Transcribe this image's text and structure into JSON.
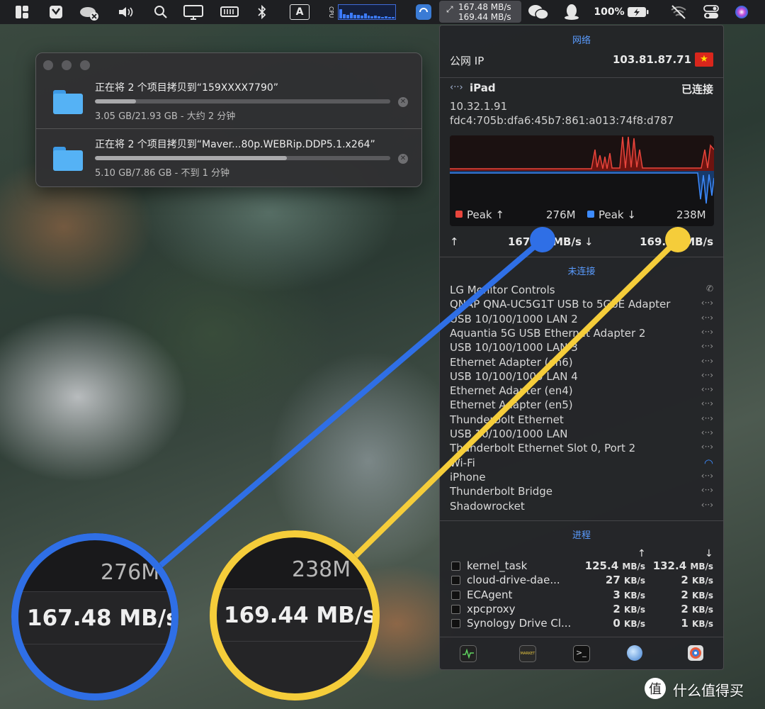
{
  "menubar": {
    "battery_pct": "100%",
    "net_up": "167.48 MB/s",
    "net_down": "169.44 MB/s",
    "cpu_label": "CPU",
    "input_label": "A",
    "cpu_levels": [
      0.7,
      0.35,
      0.3,
      0.45,
      0.3,
      0.25,
      0.2,
      0.4,
      0.2,
      0.15,
      0.2,
      0.15,
      0.1,
      0.15,
      0.1,
      0.12
    ]
  },
  "copy_window": {
    "items": [
      {
        "title": "正在将 2 个项目拷贝到“159XXXX7790”",
        "status": "3.05 GB/21.93 GB - 大约 2 分钟",
        "progress": 0.139
      },
      {
        "title": "正在将 2 个项目拷贝到“Maver...80p.WEBRip.DDP5.1.x264”",
        "status": "5.10 GB/7.86 GB - 不到 1 分钟",
        "progress": 0.649
      }
    ]
  },
  "network": {
    "section_title": "网络",
    "public_ip_label": "公网 IP",
    "public_ip": "103.81.87.71",
    "device_name": "iPad",
    "device_status": "已连接",
    "ipv4": "10.32.1.91",
    "ipv6": "fdc4:705b:dfa6:45b7:861:a013:74f8:d787",
    "peak_up_label": "Peak ↑",
    "peak_up_value": "276M",
    "peak_down_label": "Peak ↓",
    "peak_down_value": "238M",
    "speed_up": "167.48 MB/s",
    "speed_down": "169.44 MB/s",
    "up_color": "#e8453c",
    "down_color": "#3d8bff"
  },
  "disconnected": {
    "section_title": "未连接",
    "interfaces": [
      {
        "name": "LG Monitor Controls",
        "icon": "phone-icon"
      },
      {
        "name": "QNAP QNA-UC5G1T USB to 5GbE Adapter",
        "icon": "ethernet-icon"
      },
      {
        "name": "USB 10/100/1000 LAN 2",
        "icon": "ethernet-icon"
      },
      {
        "name": "Aquantia 5G USB Ethernet Adapter 2",
        "icon": "ethernet-icon"
      },
      {
        "name": "USB 10/100/1000 LAN 3",
        "icon": "ethernet-icon"
      },
      {
        "name": "Ethernet Adapter (en6)",
        "icon": "ethernet-icon"
      },
      {
        "name": "USB 10/100/1000 LAN 4",
        "icon": "ethernet-icon"
      },
      {
        "name": "Ethernet Adapter (en4)",
        "icon": "ethernet-icon"
      },
      {
        "name": "Ethernet Adapter (en5)",
        "icon": "ethernet-icon"
      },
      {
        "name": "Thunderbolt Ethernet",
        "icon": "ethernet-icon"
      },
      {
        "name": "USB 10/100/1000 LAN",
        "icon": "ethernet-icon"
      },
      {
        "name": "Thunderbolt Ethernet Slot 0, Port 2",
        "icon": "ethernet-icon"
      },
      {
        "name": "Wi-Fi",
        "icon": "wifi-icon"
      },
      {
        "name": "iPhone",
        "icon": "ethernet-icon"
      },
      {
        "name": "Thunderbolt Bridge",
        "icon": "ethernet-icon"
      },
      {
        "name": "Shadowrocket",
        "icon": "ethernet-icon"
      }
    ]
  },
  "processes": {
    "section_title": "进程",
    "up_header": "↑",
    "down_header": "↓",
    "rows": [
      {
        "name": "kernel_task",
        "up": "125.4",
        "up_unit": "MB/s",
        "down": "132.4",
        "down_unit": "MB/s"
      },
      {
        "name": "cloud-drive-dae...",
        "up": "27",
        "up_unit": "KB/s",
        "down": "2",
        "down_unit": "KB/s"
      },
      {
        "name": "ECAgent",
        "up": "3",
        "up_unit": "KB/s",
        "down": "2",
        "down_unit": "KB/s"
      },
      {
        "name": "xpcproxy",
        "up": "2",
        "up_unit": "KB/s",
        "down": "2",
        "down_unit": "KB/s"
      },
      {
        "name": "Synology Drive Cl...",
        "up": "0",
        "up_unit": "KB/s",
        "down": "1",
        "down_unit": "KB/s"
      }
    ]
  },
  "toolbar_icons": [
    "activity-monitor-icon",
    "market-icon",
    "terminal-icon",
    "network-globe-icon",
    "disk-utility-icon"
  ],
  "callouts": {
    "left": {
      "peak": "276M",
      "speed": "167.48 MB/s",
      "color": "#2f6fe6"
    },
    "right": {
      "peak": "238M",
      "speed": "169.44 MB/s",
      "color": "#f5cd3a"
    }
  },
  "watermark": "什么值得买"
}
